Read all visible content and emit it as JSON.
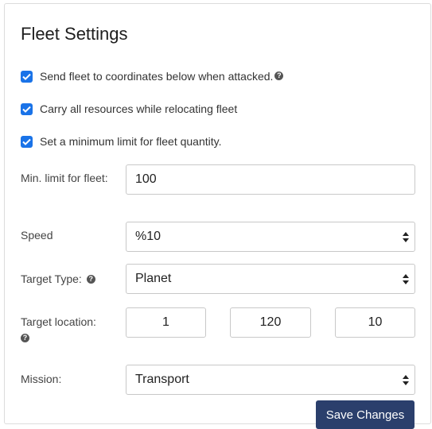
{
  "panel": {
    "title": "Fleet Settings"
  },
  "checkboxes": [
    {
      "label": "Send fleet to coordinates below when attacked.",
      "checked": true,
      "help_icon": "question-circle-icon"
    },
    {
      "label": "Carry all resources while relocating fleet",
      "checked": true
    },
    {
      "label": "Set a minimum limit for fleet quantity.",
      "checked": true
    }
  ],
  "fields": {
    "min_limit": {
      "label": "Min. limit for fleet:",
      "value": "100"
    },
    "speed": {
      "label": "Speed",
      "value": "%10"
    },
    "target_type": {
      "label": "Target Type:",
      "value": "Planet",
      "help_icon": "question-circle-icon"
    },
    "target_location": {
      "label": "Target location:",
      "galaxy": "1",
      "system": "120",
      "position": "10",
      "help_icon": "question-circle-icon"
    },
    "mission": {
      "label": "Mission:",
      "value": "Transport"
    }
  },
  "actions": {
    "save_label": "Save Changes"
  },
  "colors": {
    "checkbox": "#1a73e8",
    "save_button": "#2b3f6c"
  }
}
